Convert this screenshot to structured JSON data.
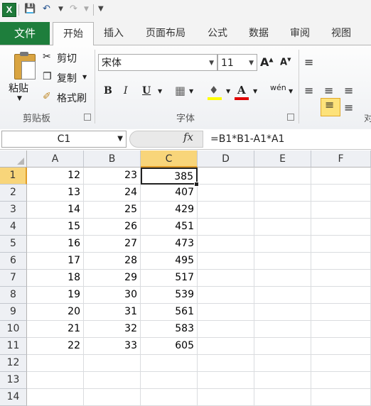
{
  "qat": {
    "app_icon": "X"
  },
  "ribbon": {
    "tabs": [
      "文件",
      "开始",
      "插入",
      "页面布局",
      "公式",
      "数据",
      "审阅",
      "视图"
    ],
    "active_tab": "开始",
    "clipboard": {
      "paste": "粘贴",
      "cut": "剪切",
      "copy": "复制",
      "format_painter": "格式刷",
      "group_label": "剪贴板"
    },
    "font": {
      "name": "宋体",
      "size": "11",
      "grow": "A",
      "shrink": "A",
      "bold": "B",
      "italic": "I",
      "underline": "U",
      "font_color": "A",
      "phonetic": "wén",
      "group_label": "字体"
    },
    "alignment": {
      "group_label_partial": "对"
    }
  },
  "formula_bar": {
    "name_box": "C1",
    "fx_label": "fx",
    "formula": "=B1*B1-A1*A1"
  },
  "grid": {
    "columns": [
      "A",
      "B",
      "C",
      "D",
      "E",
      "F"
    ],
    "selected_column": "C",
    "selected_row": "1",
    "rows": [
      {
        "n": "1",
        "a": "12",
        "b": "23",
        "c": "385"
      },
      {
        "n": "2",
        "a": "13",
        "b": "24",
        "c": "407"
      },
      {
        "n": "3",
        "a": "14",
        "b": "25",
        "c": "429"
      },
      {
        "n": "4",
        "a": "15",
        "b": "26",
        "c": "451"
      },
      {
        "n": "5",
        "a": "16",
        "b": "27",
        "c": "473"
      },
      {
        "n": "6",
        "a": "17",
        "b": "28",
        "c": "495"
      },
      {
        "n": "7",
        "a": "18",
        "b": "29",
        "c": "517"
      },
      {
        "n": "8",
        "a": "19",
        "b": "30",
        "c": "539"
      },
      {
        "n": "9",
        "a": "20",
        "b": "31",
        "c": "561"
      },
      {
        "n": "10",
        "a": "21",
        "b": "32",
        "c": "583"
      },
      {
        "n": "11",
        "a": "22",
        "b": "33",
        "c": "605"
      },
      {
        "n": "12",
        "a": "",
        "b": "",
        "c": ""
      },
      {
        "n": "13",
        "a": "",
        "b": "",
        "c": ""
      },
      {
        "n": "14",
        "a": "",
        "b": "",
        "c": ""
      }
    ]
  },
  "colors": {
    "file_tab": "#1e7e3c",
    "selection_header": "#f8d57a",
    "selection_accent": "#e09c28"
  }
}
